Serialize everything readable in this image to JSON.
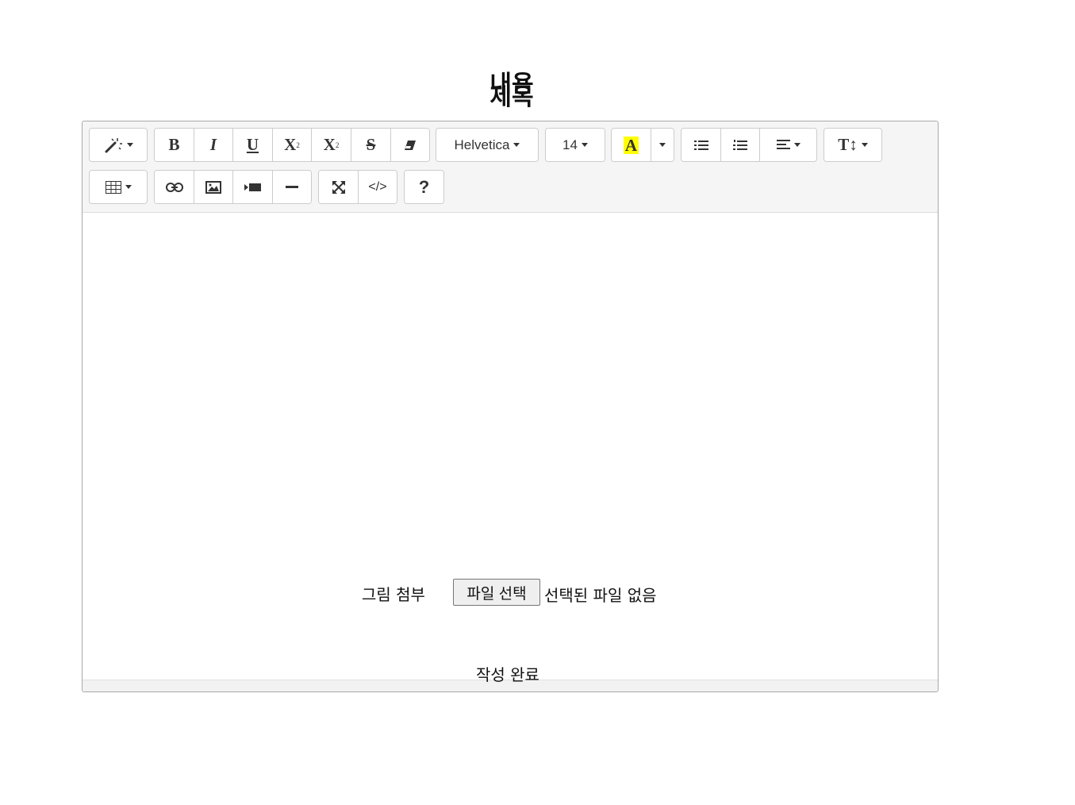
{
  "page": {
    "heading_line1": "내용",
    "heading_line2": "제목"
  },
  "toolbar": {
    "font_name": "Helvetica",
    "font_size": "14",
    "highlight_letter": "A",
    "highlight_color": "#ffff00",
    "bold": "B",
    "italic": "I",
    "underline": "U",
    "superscript": "X",
    "subscript": "X",
    "strikethrough": "S",
    "line_height": "T↕",
    "help": "?",
    "code_view": "</>"
  },
  "form": {
    "attach_label": "그림 첨부",
    "file_button": "파일 선택",
    "file_status": "선택된 파일 없음",
    "submit_label": "작성 완료"
  }
}
